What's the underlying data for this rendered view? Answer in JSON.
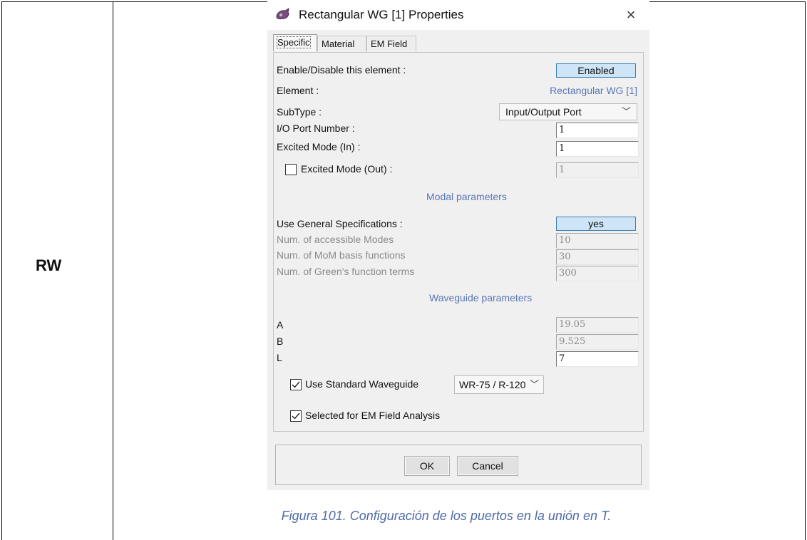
{
  "document": {
    "row_label": "RW",
    "caption": "Figura 101. Configuración de los puertos en la unión en T."
  },
  "dialog": {
    "title": "Rectangular WG [1] Properties",
    "title_icon": "app-logo-icon",
    "close_label": "×",
    "tabs": [
      {
        "label": "Specific",
        "active": true
      },
      {
        "label": "Material",
        "active": false
      },
      {
        "label": "EM Field",
        "active": false
      }
    ],
    "specific": {
      "enable_label": "Enable/Disable this element :",
      "enable_value": "Enabled",
      "element_label": "Element :",
      "element_value": "Rectangular WG [1]",
      "subtype_label": "SubType :",
      "subtype_value": "Input/Output Port",
      "io_port_label": "I/O Port Number :",
      "io_port_value": "1",
      "excited_in_label": "Excited Mode (In) :",
      "excited_in_value": "1",
      "excited_out_label": "Excited Mode (Out) :",
      "excited_out_value": "1",
      "excited_out_checked": false,
      "modal_section": "Modal parameters",
      "use_general_label": "Use General Specifications :",
      "use_general_value": "yes",
      "accessible_modes_label": "Num. of accessible Modes",
      "accessible_modes_value": "10",
      "mom_basis_label": "Num. of MoM basis functions",
      "mom_basis_value": "30",
      "green_terms_label": "Num. of Green's function terms",
      "green_terms_value": "300",
      "waveguide_section": "Waveguide parameters",
      "a_label": "A",
      "a_value": "19.05",
      "b_label": "B",
      "b_value": "9.525",
      "l_label": "L",
      "l_value": "7",
      "use_standard_label": "Use Standard Waveguide",
      "use_standard_checked": true,
      "standard_value": "WR-75 / R-120",
      "em_field_label": "Selected for EM Field Analysis",
      "em_field_checked": true
    },
    "buttons": {
      "ok": "OK",
      "cancel": "Cancel"
    }
  }
}
